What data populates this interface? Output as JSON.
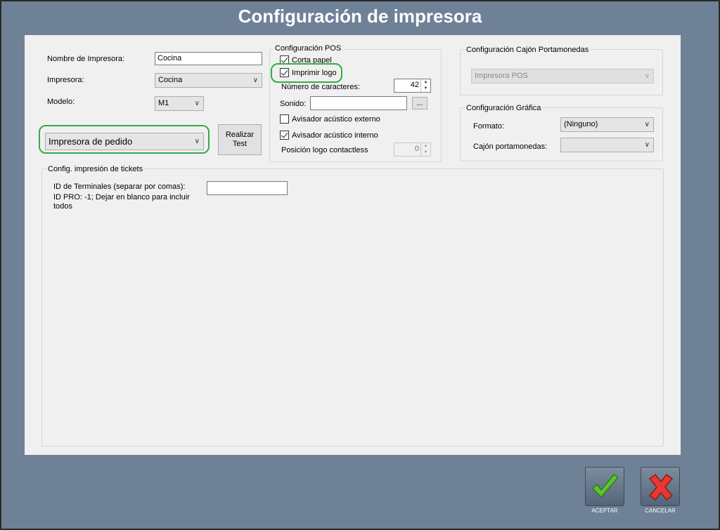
{
  "window": {
    "title": "Configuración de impresora"
  },
  "printer": {
    "name_label": "Nombre de Impresora:",
    "name_value": "Cocina",
    "printer_label": "Impresora:",
    "printer_value": "Cocina",
    "model_label": "Modelo:",
    "model_value": "M1",
    "type_value": "Impresora de pedido",
    "test_button": "Realizar Test"
  },
  "pos": {
    "title": "Configuración POS",
    "corta_papel": "Corta papel",
    "imprimir_logo": "Imprimir logo",
    "num_caracteres_label": "Número de caracteres:",
    "num_caracteres_value": "42",
    "sonido_label": "Sonido:",
    "sonido_value": "",
    "browse_button": "...",
    "avisador_externo": "Avisador acústico externo",
    "avisador_interno": "Avisador acústico interno",
    "posicion_logo_label": "Posición logo contactless",
    "posicion_logo_value": "0"
  },
  "cajon": {
    "title": "Configuración Cajón Portamonedas",
    "value": "Impresora POS"
  },
  "grafica": {
    "title": "Configuración Gráfica",
    "formato_label": "Formato:",
    "formato_value": "(Ninguno)",
    "cajon_label": "Cajón portamonedas:",
    "cajon_value": ""
  },
  "tickets": {
    "title": "Config. impresión de tickets",
    "terminales_line1": "ID de Terminales (separar por comas):",
    "terminales_line2": "ID PRO: -1; Dejar en blanco para incluir",
    "terminales_line3": "todos",
    "terminales_value": ""
  },
  "actions": {
    "accept": "ACEPTAR",
    "cancel": "CANCELAR"
  },
  "colors": {
    "background": "#6e8196",
    "panel": "#f0f0f0",
    "highlight": "#2fae48",
    "accept_icon": "#5cc23a",
    "cancel_icon": "#e53935"
  }
}
